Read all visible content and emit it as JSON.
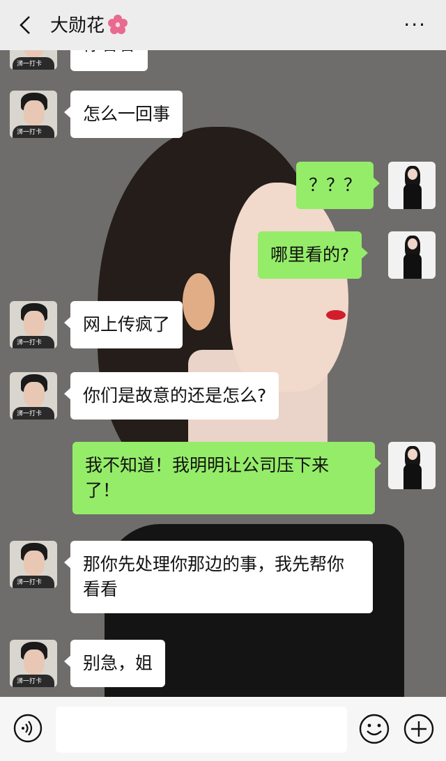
{
  "header": {
    "title": "大勋花",
    "flower_emoji": "🌸",
    "more": "···"
  },
  "messages": [
    {
      "side": "left",
      "text": "你看看",
      "partial": true
    },
    {
      "side": "left",
      "text": "怎么一回事"
    },
    {
      "side": "right",
      "text": "？？？"
    },
    {
      "side": "right",
      "text": "哪里看的?"
    },
    {
      "side": "left",
      "text": "网上传疯了"
    },
    {
      "side": "left",
      "text": "你们是故意的还是怎么?"
    },
    {
      "side": "right",
      "text": "我不知道！我明明让公司压下来了！"
    },
    {
      "side": "left",
      "text": "那你先处理你那边的事，我先帮你看看"
    },
    {
      "side": "left",
      "text": "别急，姐"
    }
  ],
  "avatars": {
    "contact_tag": "浉一打卡"
  },
  "input": {
    "placeholder": ""
  },
  "colors": {
    "right_bubble": "#95ec69",
    "left_bubble": "#ffffff",
    "header_bg": "#ededed"
  }
}
